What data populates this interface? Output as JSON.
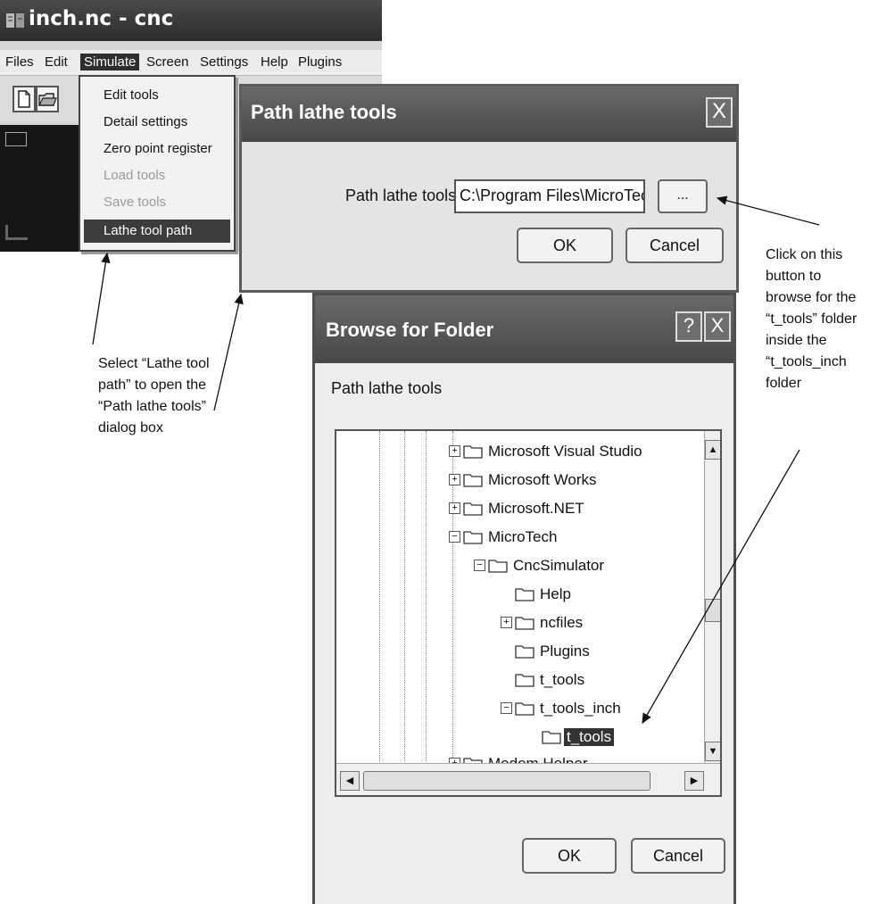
{
  "app": {
    "title": "inch.nc - cnc",
    "menu": [
      "Files",
      "Edit",
      "Simulate",
      "Screen",
      "Settings",
      "Help",
      "Plugins"
    ],
    "active_menu": "Simulate",
    "simulate_menu": [
      {
        "label": "Edit tools",
        "state": "enabled"
      },
      {
        "label": "Detail settings",
        "state": "enabled"
      },
      {
        "label": "Zero point register",
        "state": "enabled"
      },
      {
        "label": "Load tools",
        "state": "disabled"
      },
      {
        "label": "Save tools",
        "state": "disabled"
      },
      {
        "label": "Lathe tool path",
        "state": "selected"
      }
    ],
    "icons": [
      "app-icon",
      "new-file-icon",
      "open-folder-icon"
    ]
  },
  "path_dialog": {
    "title": "Path lathe tools",
    "close": "X",
    "field_label": "Path lathe tools",
    "field_value": "C:\\Program Files\\MicroTech",
    "browse_label": "...",
    "ok": "OK",
    "cancel": "Cancel"
  },
  "browse_dialog": {
    "title": "Browse for Folder",
    "help": "?",
    "close": "X",
    "description": "Path lathe tools",
    "tree": [
      {
        "label": "Microsoft Visual Studio",
        "expander": "+"
      },
      {
        "label": "Microsoft Works",
        "expander": "+"
      },
      {
        "label": "Microsoft.NET",
        "expander": "+"
      },
      {
        "label": "MicroTech",
        "expander": "−"
      },
      {
        "label": "CncSimulator",
        "expander": "−"
      },
      {
        "label": "Help",
        "expander": ""
      },
      {
        "label": "ncfiles",
        "expander": "+"
      },
      {
        "label": "Plugins",
        "expander": ""
      },
      {
        "label": "t_tools",
        "expander": ""
      },
      {
        "label": "t_tools_inch",
        "expander": "−"
      },
      {
        "label": "t_tools",
        "expander": "",
        "selected": true
      },
      {
        "label": "Modem Helper",
        "expander": "+"
      }
    ],
    "ok": "OK",
    "cancel": "Cancel"
  },
  "annotations": {
    "select_note": "Select “Lathe tool path” to open the “Path lathe tools” dialog box",
    "click_note": "Click on this button to browse for the “t_tools” folder inside the “t_tools_inch folder"
  },
  "colors": {
    "titlebar": "#474747",
    "highlight": "#3c3c3c",
    "dialog_bg": "#e4e4e4"
  }
}
